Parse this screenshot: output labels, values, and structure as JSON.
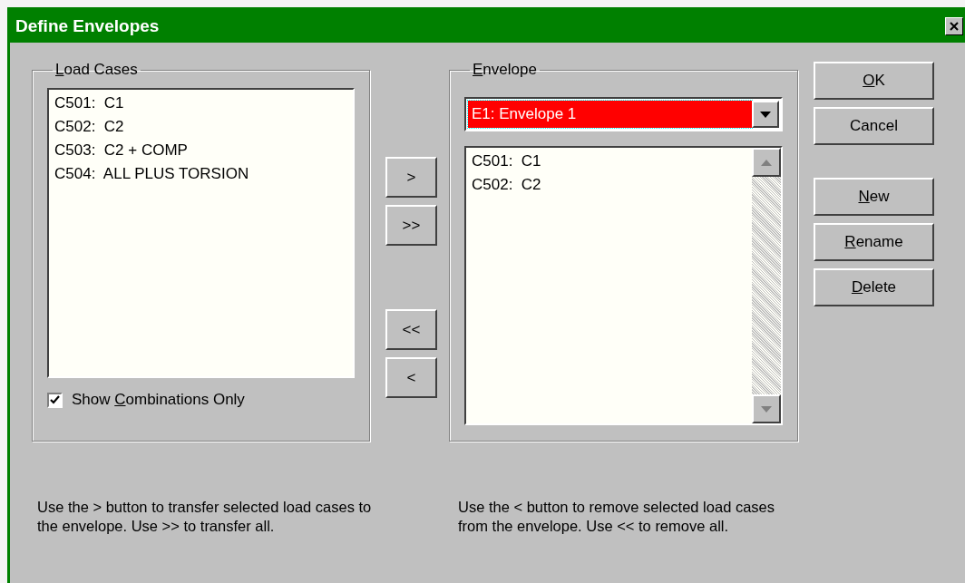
{
  "window": {
    "title": "Define Envelopes"
  },
  "load_cases": {
    "title": {
      "key": "L",
      "rest": "oad Cases"
    },
    "items": [
      "C501:  C1",
      "C502:  C2",
      "C503:  C2 + COMP",
      "C504:  ALL PLUS TORSION"
    ],
    "show_combinations": {
      "label": {
        "lead": "Show ",
        "key": "C",
        "rest": "ombinations Only"
      },
      "checked": true
    }
  },
  "add_buttons": [
    ">",
    ">>"
  ],
  "remove_buttons": [
    "<<",
    "<"
  ],
  "envelope": {
    "title": {
      "key": "E",
      "rest": "nvelope"
    },
    "selected_envelope": "E1: Envelope 1",
    "highlighted": true,
    "items": [
      "C501:  C1",
      "C502:  C2"
    ]
  },
  "buttons": [
    {
      "label": {
        "key": "O",
        "rest": "K"
      }
    },
    {
      "label": {
        "lead": "Cancel"
      }
    },
    {
      "label": {
        "key": "N",
        "rest": "ew"
      }
    },
    {
      "label": {
        "key": "R",
        "rest": "ename"
      }
    },
    {
      "label": {
        "key": "D",
        "rest": "elete"
      }
    }
  ],
  "help_texts": [
    "Use the > button to transfer selected load cases to the envelope. Use >> to transfer all.",
    "Use the < button to remove selected load cases from the envelope. Use << to remove all."
  ]
}
